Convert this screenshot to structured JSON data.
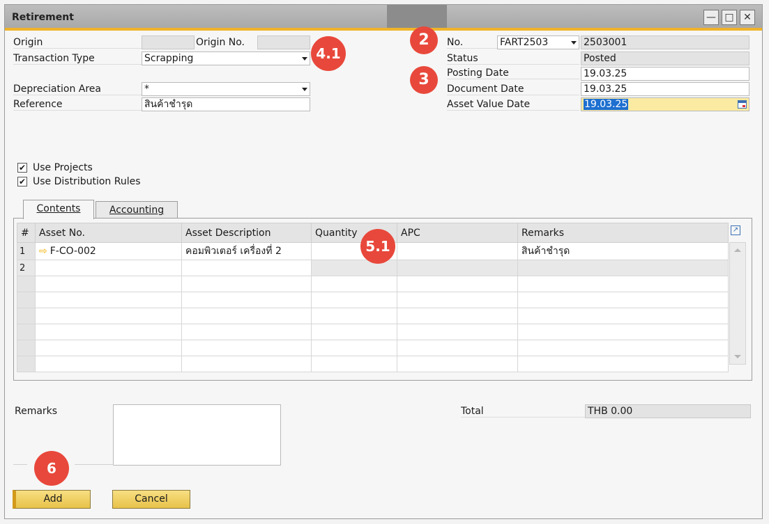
{
  "window": {
    "title": "Retirement",
    "controls": [
      "minimize-icon",
      "maximize-icon",
      "close-icon"
    ]
  },
  "header_left": {
    "origin_label": "Origin",
    "origin_value": "",
    "origin_no_label": "Origin No.",
    "origin_no_value": "",
    "transaction_type_label": "Transaction Type",
    "transaction_type_value": "Scrapping",
    "depreciation_area_label": "Depreciation Area",
    "depreciation_area_value": "*",
    "reference_label": "Reference",
    "reference_value": "สินค้าชำรุด"
  },
  "header_right": {
    "no_label": "No.",
    "series_value": "FART2503",
    "no_value": "2503001",
    "status_label": "Status",
    "status_value": "Posted",
    "posting_date_label": "Posting Date",
    "posting_date_value": "19.03.25",
    "document_date_label": "Document Date",
    "document_date_value": "19.03.25",
    "asset_value_date_label": "Asset Value Date",
    "asset_value_date_value": "19.03.25"
  },
  "options": {
    "use_projects_label": "Use Projects",
    "use_projects_checked": true,
    "use_distribution_rules_label": "Use Distribution Rules",
    "use_distribution_rules_checked": true
  },
  "tabs": [
    {
      "label": "Contents",
      "active": true
    },
    {
      "label": "Accounting",
      "active": false
    }
  ],
  "grid": {
    "columns": [
      "#",
      "Asset No.",
      "Asset Description",
      "Quantity",
      "APC",
      "Remarks"
    ],
    "rows": [
      {
        "num": "1",
        "asset_no": "F-CO-002",
        "description": "คอมพิวเตอร์ เครื่องที่ 2",
        "quantity": "",
        "apc": "",
        "remarks": "สินค้าชำรุด"
      },
      {
        "num": "2",
        "asset_no": "",
        "description": "",
        "quantity": "",
        "apc": "",
        "remarks": ""
      }
    ]
  },
  "footer": {
    "remarks_label": "Remarks",
    "remarks_value": "",
    "total_label": "Total",
    "total_value": "THB 0.00"
  },
  "buttons": {
    "add_label": "Add",
    "cancel_label": "Cancel"
  },
  "markers": {
    "m2": "2",
    "m3": "3",
    "m41": "4.1",
    "m51": "5.1",
    "m6": "6"
  },
  "colors": {
    "accent": "#f0b429",
    "marker": "#e8483b",
    "highlight_field": "#fbeaa2",
    "selection": "#1d6fd0"
  }
}
